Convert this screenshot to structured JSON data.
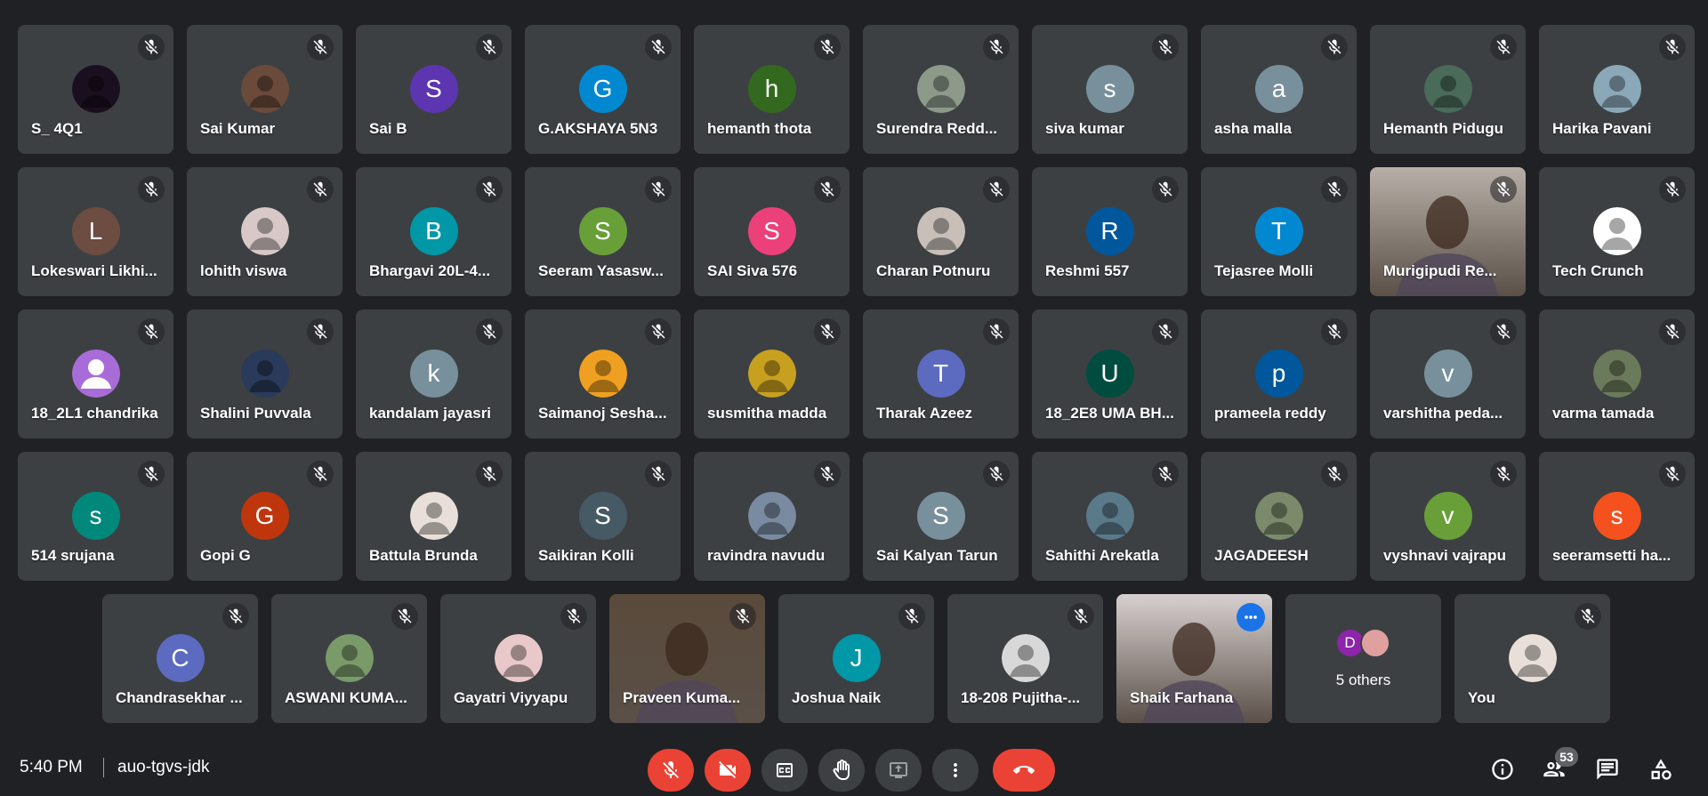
{
  "participants": [
    {
      "name": "S_ 4Q1",
      "avatar": "photo",
      "color": "#1a0f1f",
      "letter": ""
    },
    {
      "name": "Sai Kumar",
      "avatar": "photo",
      "color": "#6a4a3a",
      "letter": ""
    },
    {
      "name": "Sai B",
      "avatar": "letter",
      "color": "#5e35b1",
      "letter": "S"
    },
    {
      "name": "G.AKSHAYA 5N3",
      "avatar": "letter",
      "color": "#0288d1",
      "letter": "G"
    },
    {
      "name": "hemanth thota",
      "avatar": "letter",
      "color": "#33691e",
      "letter": "h"
    },
    {
      "name": "Surendra Redd...",
      "avatar": "photo",
      "color": "#8d9a8a",
      "letter": ""
    },
    {
      "name": "siva kumar",
      "avatar": "letter",
      "color": "#78909c",
      "letter": "s"
    },
    {
      "name": "asha malla",
      "avatar": "letter",
      "color": "#78909c",
      "letter": "a"
    },
    {
      "name": "Hemanth Pidugu",
      "avatar": "photo",
      "color": "#4a6a5a",
      "letter": ""
    },
    {
      "name": "Harika Pavani",
      "avatar": "photo",
      "color": "#8aa8b8",
      "letter": ""
    },
    {
      "name": "Lokeswari Likhi...",
      "avatar": "letter",
      "color": "#6d4c41",
      "letter": "L"
    },
    {
      "name": "lohith viswa",
      "avatar": "photo",
      "color": "#d8c8c8",
      "letter": ""
    },
    {
      "name": "Bhargavi 20L-4...",
      "avatar": "letter",
      "color": "#0097a7",
      "letter": "B"
    },
    {
      "name": "Seeram Yasasw...",
      "avatar": "letter",
      "color": "#689f38",
      "letter": "S"
    },
    {
      "name": "SAI Siva 576",
      "avatar": "letter",
      "color": "#ec407a",
      "letter": "S"
    },
    {
      "name": "Charan Potnuru",
      "avatar": "photo",
      "color": "#c8c0b8",
      "letter": ""
    },
    {
      "name": "Reshmi 557",
      "avatar": "letter",
      "color": "#01579b",
      "letter": "R"
    },
    {
      "name": "Tejasree Molli",
      "avatar": "letter",
      "color": "#0288d1",
      "letter": "T"
    },
    {
      "name": "Murigipudi Re...",
      "avatar": "video",
      "color": "#b8b0a8",
      "letter": ""
    },
    {
      "name": "Tech Crunch",
      "avatar": "photo",
      "color": "#ffffff",
      "letter": ""
    },
    {
      "name": "18_2L1 chandrika",
      "avatar": "person",
      "color": "#a86cd8",
      "letter": ""
    },
    {
      "name": "Shalini Puvvala",
      "avatar": "photo",
      "color": "#2a3a5a",
      "letter": ""
    },
    {
      "name": "kandalam jayasri",
      "avatar": "letter",
      "color": "#78909c",
      "letter": "k"
    },
    {
      "name": "Saimanoj Sesha...",
      "avatar": "photo",
      "color": "#f0a020",
      "letter": ""
    },
    {
      "name": "susmitha madda",
      "avatar": "photo",
      "color": "#c8a020",
      "letter": ""
    },
    {
      "name": "Tharak Azeez",
      "avatar": "letter",
      "color": "#5c6bc0",
      "letter": "T"
    },
    {
      "name": "18_2E8 UMA BH...",
      "avatar": "letter",
      "color": "#004d40",
      "letter": "U"
    },
    {
      "name": "prameela reddy",
      "avatar": "letter",
      "color": "#01579b",
      "letter": "p"
    },
    {
      "name": "varshitha peda...",
      "avatar": "letter",
      "color": "#78909c",
      "letter": "v"
    },
    {
      "name": "varma tamada",
      "avatar": "photo",
      "color": "#6a7a5a",
      "letter": ""
    },
    {
      "name": "514 srujana",
      "avatar": "letter",
      "color": "#00897b",
      "letter": "s"
    },
    {
      "name": "Gopi G",
      "avatar": "letter",
      "color": "#bf360c",
      "letter": "G"
    },
    {
      "name": "Battula Brunda",
      "avatar": "photo",
      "color": "#e8e0d8",
      "letter": ""
    },
    {
      "name": "Saikiran Kolli",
      "avatar": "letter",
      "color": "#455a64",
      "letter": "S"
    },
    {
      "name": "ravindra navudu",
      "avatar": "photo",
      "color": "#7a8aa0",
      "letter": ""
    },
    {
      "name": "Sai Kalyan Tarun",
      "avatar": "letter",
      "color": "#78909c",
      "letter": "S"
    },
    {
      "name": "Sahithi Arekatla",
      "avatar": "photo",
      "color": "#5a7a8a",
      "letter": ""
    },
    {
      "name": "JAGADEESH",
      "avatar": "photo",
      "color": "#7a8a6a",
      "letter": ""
    },
    {
      "name": "vyshnavi vajrapu",
      "avatar": "letter",
      "color": "#689f38",
      "letter": "v"
    },
    {
      "name": "seeramsetti ha...",
      "avatar": "letter",
      "color": "#f4511e",
      "letter": "s"
    },
    {
      "name": "Chandrasekhar ...",
      "avatar": "letter",
      "color": "#5c6bc0",
      "letter": "C"
    },
    {
      "name": "ASWANI KUMA...",
      "avatar": "photo",
      "color": "#7a9a6a",
      "letter": ""
    },
    {
      "name": "Gayatri Viyyapu",
      "avatar": "photo",
      "color": "#e8c8c8",
      "letter": ""
    },
    {
      "name": "Praveen Kuma...",
      "avatar": "video",
      "color": "#5a4a3a",
      "letter": ""
    },
    {
      "name": "Joshua Naik",
      "avatar": "letter",
      "color": "#0097a7",
      "letter": "J"
    },
    {
      "name": "18-208 Pujitha-...",
      "avatar": "photo",
      "color": "#d8d8d8",
      "letter": ""
    },
    {
      "name": "Shaik Farhana",
      "avatar": "video",
      "color": "#d8d0d0",
      "letter": ""
    },
    {
      "name": "You",
      "avatar": "photo",
      "color": "#e8e0d8",
      "letter": ""
    }
  ],
  "others_tile": {
    "label": "5 others",
    "mini_avatars": [
      {
        "letter": "D",
        "color": "#8e24aa"
      },
      {
        "letter": "",
        "color": "#e0a0a0"
      }
    ]
  },
  "speaking": "Shaik Farhana",
  "bottom_bar": {
    "time": "5:40 PM",
    "meeting_code": "auo-tgvs-jdk",
    "people_count": "53"
  },
  "controls": [
    {
      "name": "microphone-button",
      "icon": "mic-off-icon",
      "state": "off"
    },
    {
      "name": "camera-button",
      "icon": "videocam-off-icon",
      "state": "off"
    },
    {
      "name": "captions-button",
      "icon": "closed-caption-icon",
      "state": "neutral"
    },
    {
      "name": "raise-hand-button",
      "icon": "hand-icon",
      "state": "neutral"
    },
    {
      "name": "present-button",
      "icon": "present-screen-icon",
      "state": "neutral"
    },
    {
      "name": "more-options-button",
      "icon": "more-vert-icon",
      "state": "neutral"
    },
    {
      "name": "leave-call-button",
      "icon": "call-end-icon",
      "state": "hangup"
    }
  ],
  "right_controls": [
    {
      "name": "meeting-details-button",
      "icon": "info-icon"
    },
    {
      "name": "people-button",
      "icon": "people-icon"
    },
    {
      "name": "chat-button",
      "icon": "chat-icon"
    },
    {
      "name": "activities-button",
      "icon": "activities-icon"
    }
  ],
  "colors": {
    "background": "#202124",
    "tile": "#3c4043",
    "danger": "#ea4335",
    "accent": "#8ab4f8"
  }
}
